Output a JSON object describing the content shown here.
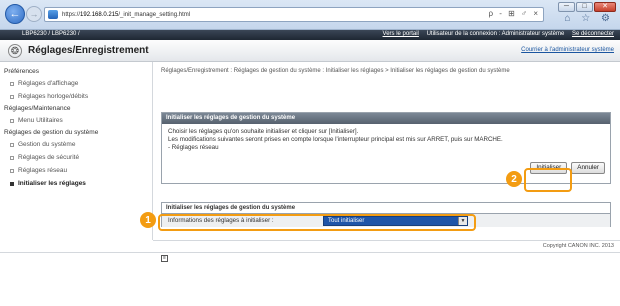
{
  "browser": {
    "url_prefix": "https://",
    "url_host": "192.168.0.215",
    "url_path": "/_init_manage_setting.html",
    "toolbar_glyphs": "ρ - ⊞ ♂ ×",
    "win_min": "─",
    "win_max": "□",
    "win_close": "✕",
    "chrome_icons": "⌂ ☆ ⚙"
  },
  "topbar": {
    "model": "LBP6230 / LBP6230 /",
    "portal_link": "Vers le portail",
    "user_label": "Utilisateur de la connexion : Administrateur système",
    "logout_link": "Se déconnecter"
  },
  "header": {
    "title": "Réglages/Enregistrement",
    "portal_link": "Courrier à l'administrateur système"
  },
  "sidebar": {
    "group1": "Préférences",
    "items1": [
      "Réglages d'affichage",
      "Réglages horloge/débits"
    ],
    "group2": "Réglages/Maintenance",
    "items2": [
      "Menu Utilitaires"
    ],
    "group3": "Réglages de gestion du système",
    "items3": [
      "Gestion du système",
      "Réglages de sécurité",
      "Réglages réseau",
      "Initialiser les réglages"
    ]
  },
  "main": {
    "breadcrumb": "Réglages/Enregistrement : Réglages de gestion du système : Initialiser les réglages > Initialiser les réglages de gestion du système",
    "panel1_title": "Initialiser les réglages de gestion du système",
    "panel1_line1": "Choisir les réglages qu'on souhaite initialiser et cliquer sur [Initialiser].",
    "panel1_line2": "Les modifications suivantes seront prises en compte lorsque l'interrupteur principal est mis sur ARRET, puis sur MARCHE.",
    "panel1_line3": "- Réglages réseau",
    "btn_init": "Initialiser",
    "btn_cancel": "Annuler",
    "panel2_title": "Initialiser les réglages de gestion du système",
    "field_label": "Informations des réglages à initialiser :",
    "select_value": "Tout initialiser"
  },
  "callouts": {
    "one": "1",
    "two": "2"
  },
  "footer": {
    "copyright": "Copyright CANON INC. 2013"
  }
}
